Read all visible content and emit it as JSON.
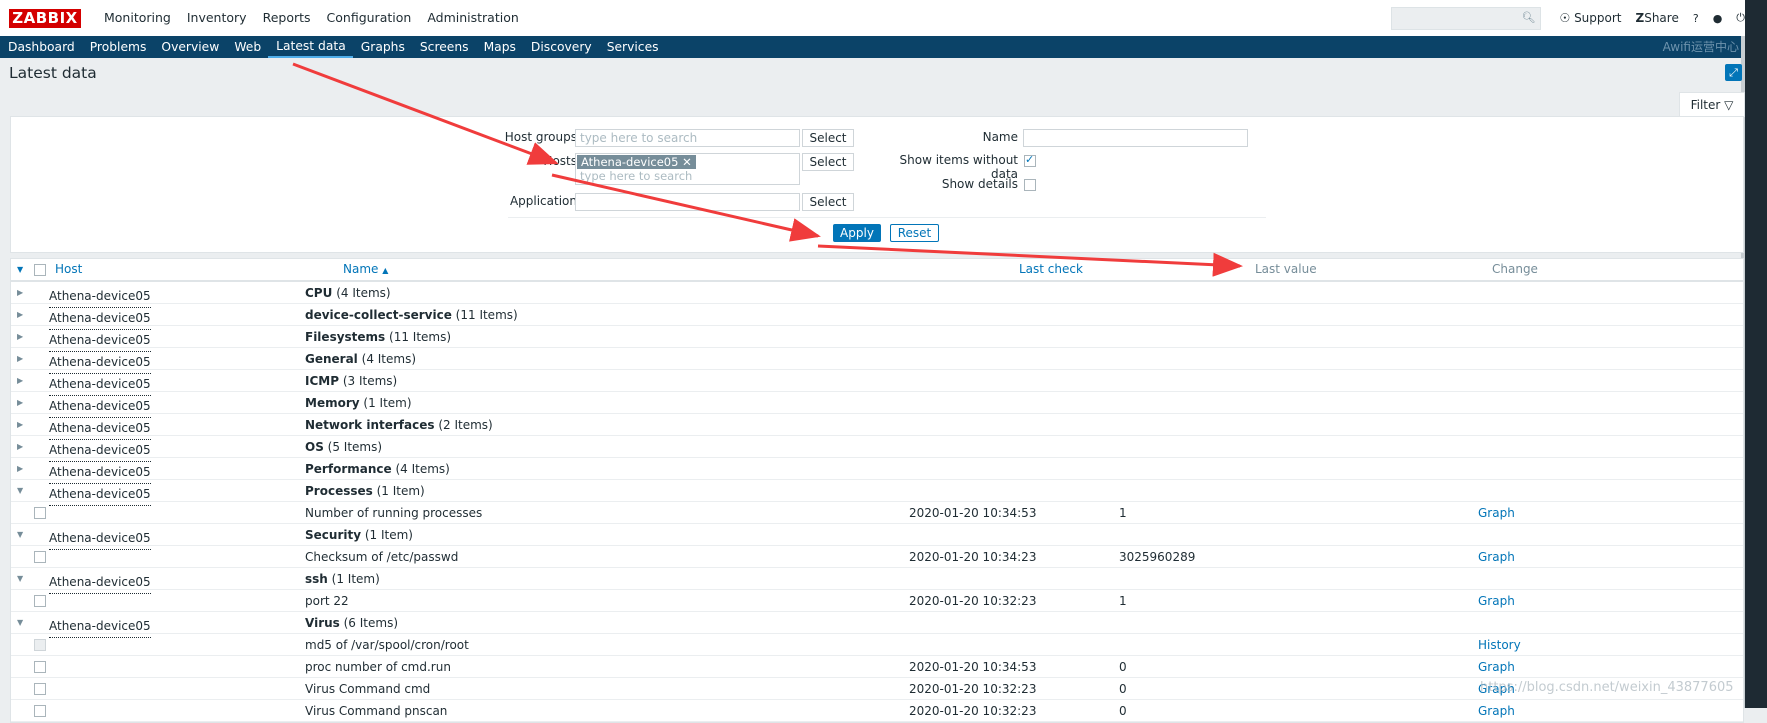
{
  "header": {
    "logo": "ZABBIX",
    "menu": [
      "Monitoring",
      "Inventory",
      "Reports",
      "Configuration",
      "Administration"
    ],
    "support": "Support",
    "share": "Share",
    "help": "?"
  },
  "subnav": {
    "items": [
      "Dashboard",
      "Problems",
      "Overview",
      "Web",
      "Latest data",
      "Graphs",
      "Screens",
      "Maps",
      "Discovery",
      "Services"
    ],
    "active": "Latest data",
    "brand": "Awifi运营中心"
  },
  "page": {
    "title": "Latest data"
  },
  "filter": {
    "tab_label": "Filter",
    "host_groups_label": "Host groups",
    "host_groups_placeholder": "type here to search",
    "hosts_label": "Hosts",
    "hosts_chip": "Athena-device05",
    "hosts_placeholder": "type here to search",
    "application_label": "Application",
    "select_label": "Select",
    "name_label": "Name",
    "show_without_data_label": "Show items without data",
    "show_without_data": true,
    "show_details_label": "Show details",
    "show_details": false,
    "apply_label": "Apply",
    "reset_label": "Reset"
  },
  "table": {
    "headers": {
      "host": "Host",
      "name": "Name",
      "last_check": "Last check",
      "last_value": "Last value",
      "change": "Change"
    },
    "rows": [
      {
        "type": "group",
        "host": "Athena-device05",
        "name": "CPU",
        "count": "(4 Items)",
        "expanded": false
      },
      {
        "type": "group",
        "host": "Athena-device05",
        "name": "device-collect-service",
        "count": "(11 Items)",
        "expanded": false
      },
      {
        "type": "group",
        "host": "Athena-device05",
        "name": "Filesystems",
        "count": "(11 Items)",
        "expanded": false
      },
      {
        "type": "group",
        "host": "Athena-device05",
        "name": "General",
        "count": "(4 Items)",
        "expanded": false
      },
      {
        "type": "group",
        "host": "Athena-device05",
        "name": "ICMP",
        "count": "(3 Items)",
        "expanded": false
      },
      {
        "type": "group",
        "host": "Athena-device05",
        "name": "Memory",
        "count": "(1 Item)",
        "expanded": false
      },
      {
        "type": "group",
        "host": "Athena-device05",
        "name": "Network interfaces",
        "count": "(2 Items)",
        "expanded": false
      },
      {
        "type": "group",
        "host": "Athena-device05",
        "name": "OS",
        "count": "(5 Items)",
        "expanded": false
      },
      {
        "type": "group",
        "host": "Athena-device05",
        "name": "Performance",
        "count": "(4 Items)",
        "expanded": false
      },
      {
        "type": "group",
        "host": "Athena-device05",
        "name": "Processes",
        "count": "(1 Item)",
        "expanded": true
      },
      {
        "type": "item",
        "name": "Number of running processes",
        "last_check": "2020-01-20 10:34:53",
        "last_value": "1",
        "action": "Graph"
      },
      {
        "type": "group",
        "host": "Athena-device05",
        "name": "Security",
        "count": "(1 Item)",
        "expanded": true
      },
      {
        "type": "item",
        "name": "Checksum of /etc/passwd",
        "last_check": "2020-01-20 10:34:23",
        "last_value": "3025960289",
        "action": "Graph"
      },
      {
        "type": "group",
        "host": "Athena-device05",
        "name": "ssh",
        "count": "(1 Item)",
        "expanded": true
      },
      {
        "type": "item",
        "name": "port 22",
        "last_check": "2020-01-20 10:32:23",
        "last_value": "1",
        "action": "Graph"
      },
      {
        "type": "group",
        "host": "Athena-device05",
        "name": "Virus",
        "count": "(6 Items)",
        "expanded": true
      },
      {
        "type": "item",
        "name": "md5 of /var/spool/cron/root",
        "last_check": "",
        "last_value": "",
        "action": "History",
        "disabled": true
      },
      {
        "type": "item",
        "name": "proc number of cmd.run",
        "last_check": "2020-01-20 10:34:53",
        "last_value": "0",
        "action": "Graph"
      },
      {
        "type": "item",
        "name": "Virus Command cmd",
        "last_check": "2020-01-20 10:32:23",
        "last_value": "0",
        "action": "Graph"
      },
      {
        "type": "item",
        "name": "Virus Command pnscan",
        "last_check": "2020-01-20 10:32:23",
        "last_value": "0",
        "action": "Graph"
      }
    ]
  },
  "watermark": "https://blog.csdn.net/weixin_43877605",
  "colors": {
    "accent": "#0275b8",
    "navbar": "#0b4368",
    "logo": "#d40000",
    "annotation": "#f03c3c"
  }
}
